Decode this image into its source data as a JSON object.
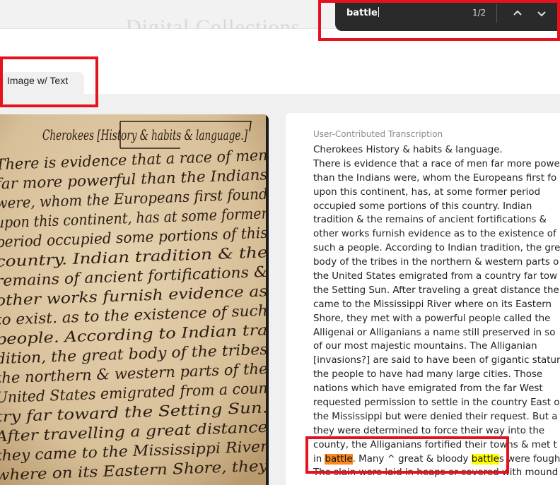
{
  "header": {
    "site_title": "Digital Collections"
  },
  "tabs": [
    {
      "label": "Image w/ Text"
    }
  ],
  "find_bar": {
    "query": "battle",
    "count": "1/2",
    "prev_icon": "chevron-up-icon",
    "next_icon": "chevron-down-icon"
  },
  "transcription": {
    "heading": "User-Contributed Transcription",
    "lines": [
      "Cherokees History & habits & language.",
      "There is evidence that a race of men far more powe",
      "than the Indians were, whom the Europeans first fo",
      "upon this continent, has, at some former period",
      "occupied some portions of this country. Indian",
      "tradition & the remains of ancient fortifications &",
      "other works furnish evidence as to the existence of",
      "such a people. According to Indian tradition, the gre",
      "body of the tribes in the northern & western parts o",
      "the United States emigrated from a country far tow",
      "the Setting Sun. After traveling a great distance the",
      "came to the Mississippi River where on its Eastern",
      "Shore, they met with a powerful people called the",
      "Alligenai or Alliganians a name still preserved in so",
      "of our most majestic mountains. The Alliganian",
      "[invasions?] are said to have been of gigantic statur",
      "the people to have had many large cities. Those",
      "nations which have emigrated from the far West",
      "requested permission to settle in the country East o",
      "the Mississippi but were denied their request. But a",
      "they were determined to force their way into the",
      "county, the Alliganians fortified their towns & met t"
    ],
    "highlight_line": {
      "pre": "in ",
      "match1": "battle",
      "mid": ". Many ^ great & bloody ",
      "match2": "battle",
      "post": "s were fough"
    },
    "last_line": "The slain were laid in heaps or covered with mound"
  },
  "manuscript": {
    "lines": [
      "Cherokees [History & habits & language.]",
      "There is evidence that a race of men",
      "far more powerful than the Indians",
      "were, whom the Europeans first found",
      "upon this continent, has at some former",
      "period occupied some portions of this",
      "country. Indian tradition & the",
      "remains of ancient fortifications &",
      "other works furnish evidence as",
      "to exist. as to the existence of such",
      "people. According to Indian tra",
      "dition, the great body of the tribes",
      "the northern & western parts of the",
      "United States emigrated from a coun",
      "try far toward the Setting Sun.",
      "After travelling a great distance",
      "they came to the Mississippi River",
      "where on its Eastern Shore, they"
    ]
  },
  "colors": {
    "annotation": "#e3141f",
    "current_match": "#f7891f",
    "other_match": "#ffff00",
    "paper": "#d9c3a0",
    "ink": "#2b1d12"
  }
}
